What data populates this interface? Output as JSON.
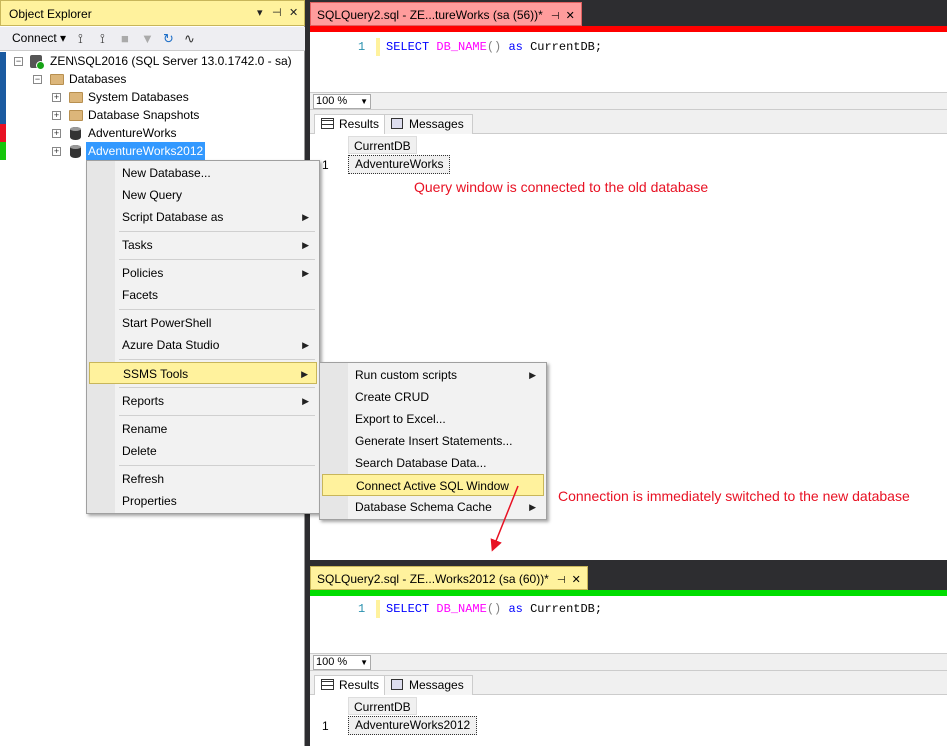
{
  "object_explorer": {
    "title": "Object Explorer",
    "connect_label": "Connect",
    "tree": {
      "server": "ZEN\\SQL2016 (SQL Server 13.0.1742.0 - sa)",
      "databases": "Databases",
      "system_databases": "System Databases",
      "snapshots": "Database Snapshots",
      "db1": "AdventureWorks",
      "db2": "AdventureWorks2012"
    }
  },
  "context_menu": {
    "items": [
      "New Database...",
      "New Query",
      "Script Database as",
      "Tasks",
      "Policies",
      "Facets",
      "Start PowerShell",
      "Azure Data Studio",
      "SSMS Tools",
      "Reports",
      "Rename",
      "Delete",
      "Refresh",
      "Properties"
    ]
  },
  "submenu": {
    "items": [
      "Run custom scripts",
      "Create CRUD",
      "Export to Excel...",
      "Generate Insert Statements...",
      "Search Database Data...",
      "Connect Active SQL Window",
      "Database Schema Cache"
    ]
  },
  "query1": {
    "tab_title": "SQLQuery2.sql - ZE...tureWorks (sa (56))*",
    "line_number": "1",
    "code_kw1": "SELECT",
    "code_fn": "DB_NAME",
    "code_paren": "()",
    "code_kw2": "as",
    "code_rest": "CurrentDB;",
    "zoom": "100 %",
    "results_tab": "Results",
    "messages_tab": "Messages",
    "column": "CurrentDB",
    "row_num": "1",
    "value": "AdventureWorks",
    "connection_color": "#ff0000"
  },
  "query2": {
    "tab_title": "SQLQuery2.sql - ZE...Works2012 (sa (60))*",
    "line_number": "1",
    "code_kw1": "SELECT",
    "code_fn": "DB_NAME",
    "code_paren": "()",
    "code_kw2": "as",
    "code_rest": "CurrentDB;",
    "zoom": "100 %",
    "results_tab": "Results",
    "messages_tab": "Messages",
    "column": "CurrentDB",
    "row_num": "1",
    "value": "AdventureWorks2012",
    "connection_color": "#00dd00"
  },
  "annotations": {
    "note1": "Query window is connected to the old database",
    "note2": "Connection is immediately switched to the new database"
  }
}
